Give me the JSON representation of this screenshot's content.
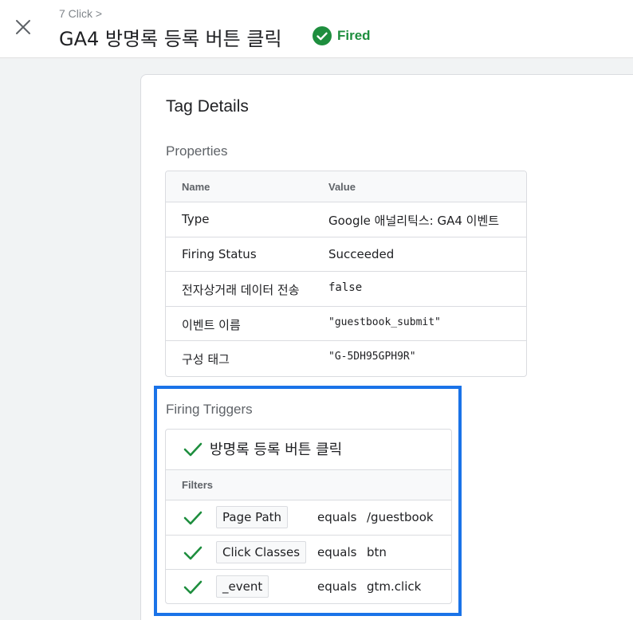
{
  "header": {
    "breadcrumb": "7 Click >",
    "title": "GA4 방명록 등록 버튼 클릭",
    "status": "Fired",
    "status_color": "#1e8e3e"
  },
  "card": {
    "title": "Tag Details",
    "properties": {
      "section_title": "Properties",
      "columns": [
        "Name",
        "Value"
      ],
      "rows": [
        {
          "name": "Type",
          "value": "Google 애널리틱스: GA4 이벤트"
        },
        {
          "name": "Firing Status",
          "value": "Succeeded"
        },
        {
          "name": "전자상거래 데이터 전송",
          "value": "false"
        },
        {
          "name": "이벤트 이름",
          "value": "\"guestbook_submit\""
        },
        {
          "name": "구성 태그",
          "value": "\"G-5DH95GPH9R\""
        }
      ]
    },
    "firing_triggers": {
      "section_title": "Firing Triggers",
      "trigger_name": "방명록 등록 버튼 클릭",
      "filters_label": "Filters",
      "filters": [
        {
          "variable": "Page Path",
          "operator": "equals",
          "value": "/guestbook"
        },
        {
          "variable": "Click Classes",
          "operator": "equals",
          "value": "btn"
        },
        {
          "variable": "_event",
          "operator": "equals",
          "value": "gtm.click"
        }
      ]
    }
  },
  "icons": {
    "close": "close-icon",
    "status": "check-circle-icon",
    "check": "check-icon"
  },
  "colors": {
    "accent_highlight": "#1a73e8",
    "success": "#1e8e3e",
    "string_value": "#a50e0e",
    "boolean_value": "#1a237e"
  }
}
